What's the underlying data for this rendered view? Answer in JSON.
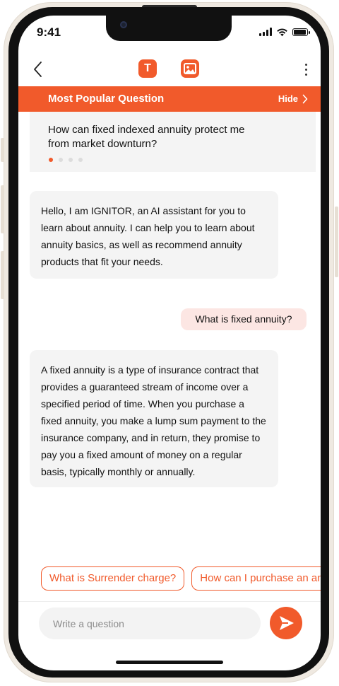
{
  "status": {
    "time": "9:41"
  },
  "nav": {
    "text_mode_letter": "T"
  },
  "popular": {
    "title": "Most Popular Question",
    "hide_label": "Hide",
    "question": "How can fixed indexed annuity protect me from market downturn?",
    "page_count": 4,
    "active_page": 1
  },
  "messages": [
    {
      "role": "assistant",
      "text": "Hello, I am IGNITOR, an AI assistant for you to learn about annuity. I can help you to learn about annuity basics, as well as recommend annuity products that fit your needs."
    },
    {
      "role": "user",
      "text": "What is fixed annuity?"
    },
    {
      "role": "assistant",
      "text": " A fixed annuity is a type of insurance contract that provides a guaranteed stream of income over a specified period of time. When you purchase a fixed annuity, you make a lump sum payment to the insurance company, and in return, they promise to pay you a fixed amount of money on a regular basis, typically monthly or annually."
    }
  ],
  "suggestions": [
    "What is Surrender charge?",
    "How can I purchase an annuity?"
  ],
  "composer": {
    "placeholder": "Write a question",
    "value": ""
  },
  "colors": {
    "accent": "#f15a2b",
    "user_bubble": "#fce6e3",
    "ai_bubble": "#f4f4f4"
  },
  "icons": {
    "back": "chevron-left-icon",
    "text_mode": "text-mode-icon",
    "image_mode": "image-icon",
    "more": "more-vertical-icon",
    "hide": "chevron-right-icon",
    "send": "send-icon"
  }
}
